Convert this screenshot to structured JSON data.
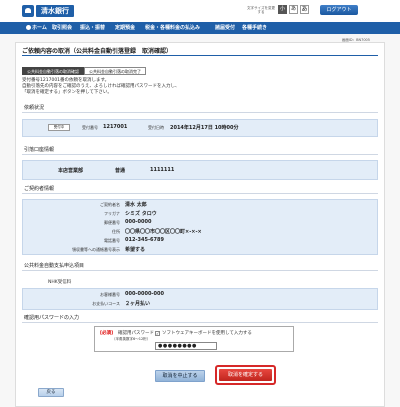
{
  "header": {
    "bank_name": "清水銀行",
    "font_size_label": "文字サイズを変更する",
    "font_sizes": [
      "小",
      "あ",
      "あ"
    ],
    "logout_label": "ログアウト"
  },
  "nav": {
    "items": [
      "ホーム",
      "取引照会",
      "振込・振替",
      "定期預金",
      "税金・各種料金の払込み",
      "諸届受付",
      "各種手続き"
    ]
  },
  "screen_id": "画面ID：BN7005",
  "page_title": "ご依頼内容の取消（公共料金自動引落登録　取消確認）",
  "steps": [
    "公共料金自動引落の取消確認",
    "公共料金自動引落の取消完了"
  ],
  "intro": {
    "line1": "受付番号1217001番の依頼を取消します。",
    "line2": "自動引落先の内容をご確認のうえ、よろしければ確認用パスワードを入力し、",
    "line3": "「取消を確定する」ボタンを押して下さい。"
  },
  "request_status": {
    "heading": "依頼状況",
    "badge": "受付中",
    "receipt_no_label": "受付番号",
    "receipt_no": "1217001",
    "receipt_date_label": "受付日時",
    "receipt_date": "2014年12月17日 10時00分"
  },
  "debit_account": {
    "heading": "引落口座情報",
    "branch": "本店営業部",
    "type": "普通",
    "number": "1111111"
  },
  "contract": {
    "heading": "ご契約者情報",
    "rows": [
      {
        "label": "ご契約者名",
        "value": "清水 太郎"
      },
      {
        "label": "フリガナ",
        "value": "シミズ タロウ"
      },
      {
        "label": "郵便番号",
        "value": "000-0000"
      },
      {
        "label": "住所",
        "value": "〇〇県〇〇市〇〇区〇〇町×-×-×"
      },
      {
        "label": "電話番号",
        "value": "012-345-6789"
      },
      {
        "label": "領収書等への通帳番号表示",
        "value": "希望する"
      }
    ]
  },
  "utility": {
    "heading": "公共料金自動支払申込項目",
    "company": "NHK受信料",
    "rows": [
      {
        "label": "お客様番号",
        "value": "000-0000-000"
      },
      {
        "label": "お支払いコース",
        "value": "２ヶ月払い"
      }
    ]
  },
  "password": {
    "heading": "確認用パスワードの入力",
    "required": "[必須]",
    "label": "確認用パスワード",
    "sublabel": "（半角英数字6～12桁）",
    "keyboard_label": "ソフトウェアキーボードを使用して入力する",
    "value": "●●●●●●●●"
  },
  "buttons": {
    "cancel": "取消を中止する",
    "confirm": "取消を確定する",
    "back": "戻る"
  },
  "colors": {
    "brand": "#1f5fa8",
    "confirm": "#d62828"
  }
}
